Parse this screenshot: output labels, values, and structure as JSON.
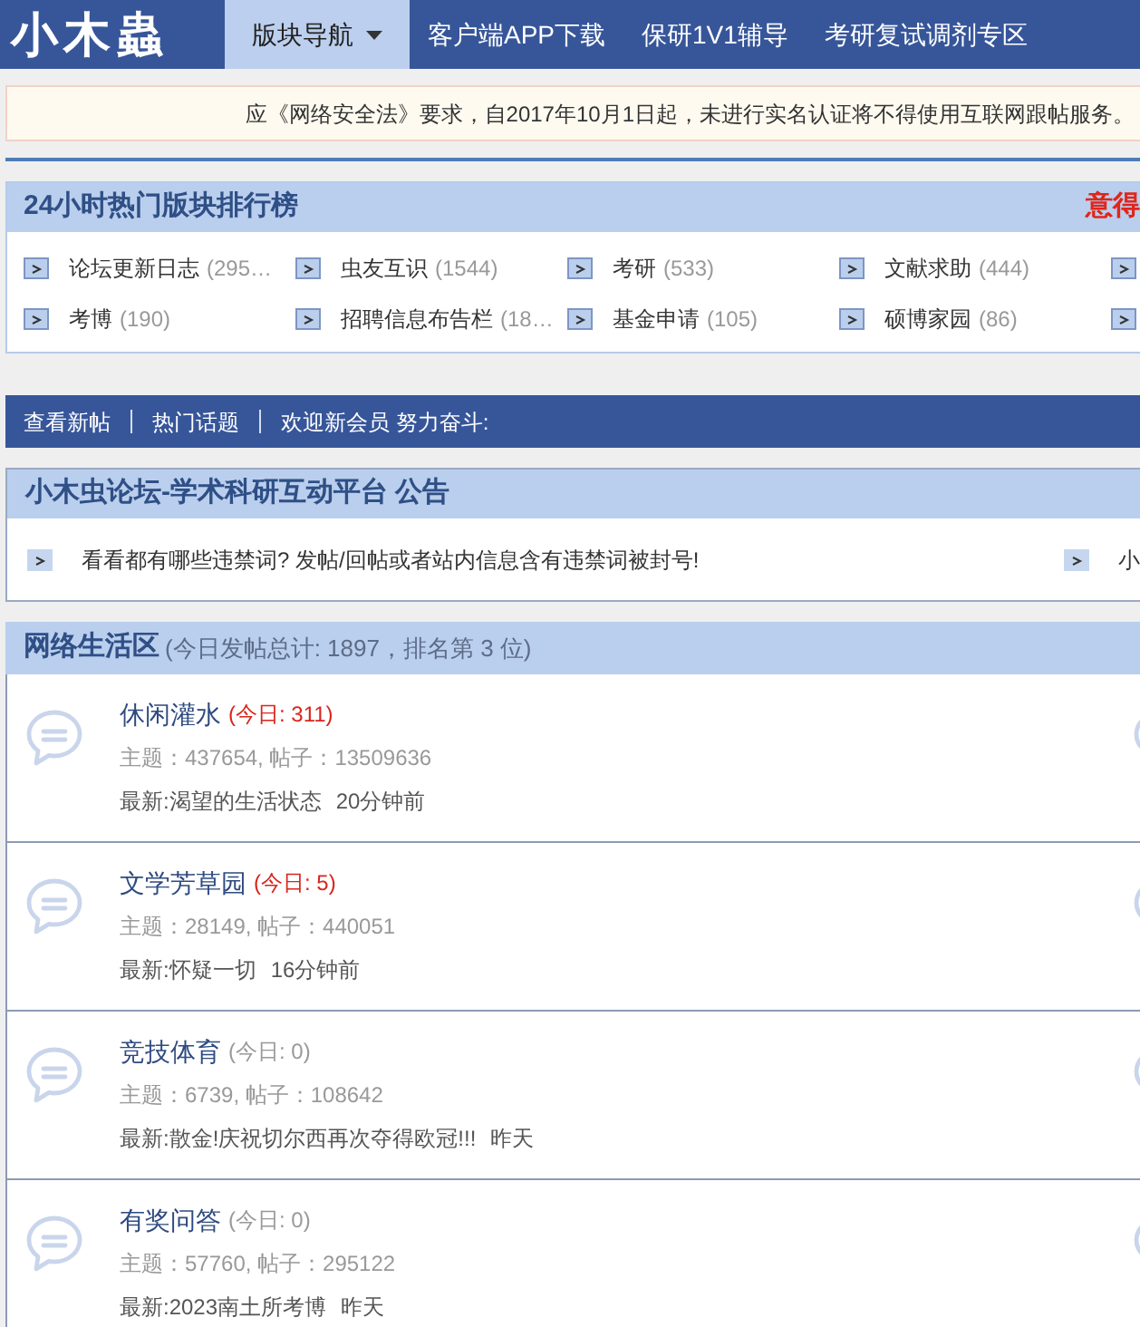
{
  "header": {
    "logo": "小木蟲",
    "nav": [
      {
        "label": "版块导航",
        "selected": true,
        "dropdown": true
      },
      {
        "label": "客户端APP下载",
        "selected": false,
        "dropdown": false
      },
      {
        "label": "保研1V1辅导",
        "selected": false,
        "dropdown": false
      },
      {
        "label": "考研复试调剂专区",
        "selected": false,
        "dropdown": false
      }
    ]
  },
  "notice": "应《网络安全法》要求，自2017年10月1日起，未进行实名认证将不得使用互联网跟帖服务。",
  "hot_boards": {
    "title": "24小时热门版块排行榜",
    "side_link": "意得",
    "rows": [
      [
        {
          "name": "论坛更新日志",
          "count": "(295…"
        },
        {
          "name": "虫友互识",
          "count": "(1544)"
        },
        {
          "name": "考研",
          "count": "(533)"
        },
        {
          "name": "文献求助",
          "count": "(444)"
        }
      ],
      [
        {
          "name": "考博",
          "count": "(190)"
        },
        {
          "name": "招聘信息布告栏",
          "count": "(18…"
        },
        {
          "name": "基金申请",
          "count": "(105)"
        },
        {
          "name": "硕博家园",
          "count": "(86)"
        }
      ]
    ]
  },
  "quick_links": {
    "links": [
      "查看新帖",
      "热门话题"
    ],
    "welcome": "欢迎新会员 努力奋斗:"
  },
  "announcement": {
    "title": "小木虫论坛-学术科研互动平台 公告",
    "items": [
      "看看都有哪些违禁词? 发帖/回帖或者站内信息含有违禁词被封号!",
      "小"
    ]
  },
  "section": {
    "title": "网络生活区",
    "summary": "(今日发帖总计: 1897，排名第 3 位)",
    "forums": [
      {
        "name": "休闲灌水",
        "today": "(今日: 311)",
        "has_new": true,
        "stats": "主题：437654, 帖子：13509636",
        "latest": "最新:渴望的生活状态",
        "time": "20分钟前"
      },
      {
        "name": "文学芳草园",
        "today": "(今日: 5)",
        "has_new": true,
        "stats": "主题：28149, 帖子：440051",
        "latest": "最新:怀疑一切",
        "time": "16分钟前"
      },
      {
        "name": "竞技体育",
        "today": "(今日: 0)",
        "has_new": false,
        "stats": "主题：6739, 帖子：108642",
        "latest": "最新:散金!庆祝切尔西再次夺得欧冠!!!",
        "time": "昨天"
      },
      {
        "name": "有奖问答",
        "today": "(今日: 0)",
        "has_new": false,
        "stats": "主题：57760, 帖子：295122",
        "latest": "最新:2023南土所考博",
        "time": "昨天"
      }
    ]
  }
}
